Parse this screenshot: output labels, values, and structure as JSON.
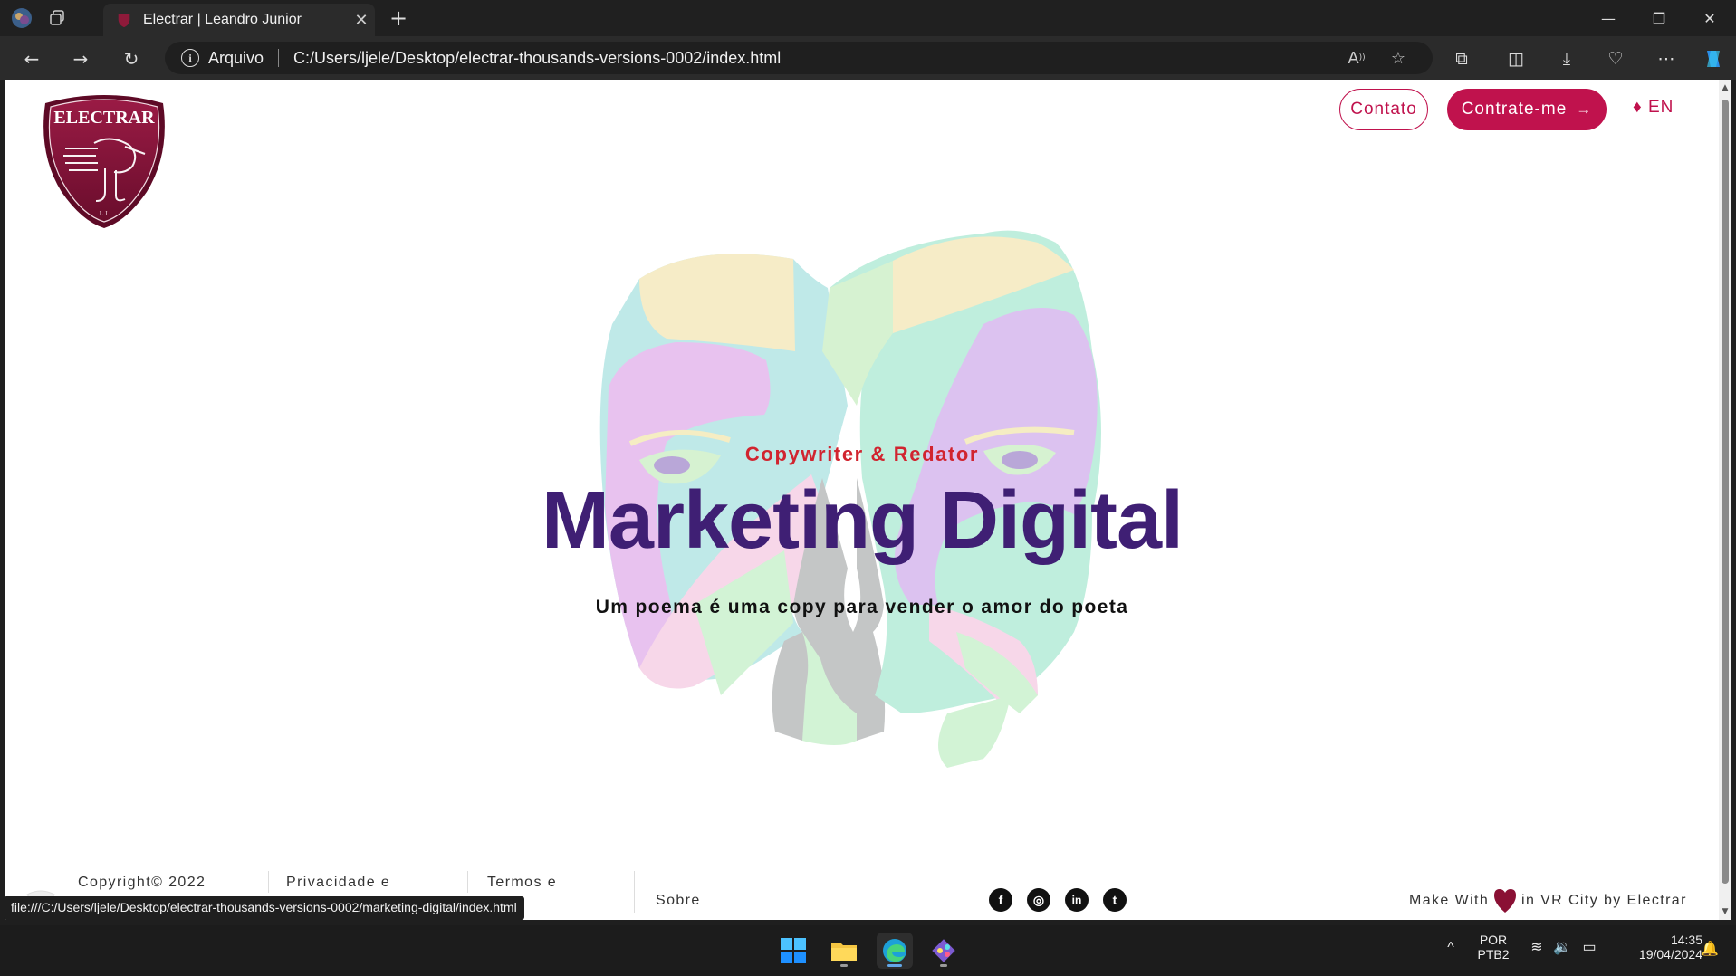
{
  "browser": {
    "tab_title": "Electrar | Leandro Junior",
    "tab_close": "✕",
    "new_tab": "+",
    "address_label": "Arquivo",
    "url": "C:/Users/ljele/Desktop/electrar-thousands-versions-0002/index.html",
    "status_link": "file:///C:/Users/ljele/Desktop/electrar-thousands-versions-0002/marketing-digital/index.html"
  },
  "site": {
    "logo_text": "ELECTRAR",
    "logo_initials": "L.J.",
    "nav": {
      "contato": "Contato",
      "contrate": "Contrate-me",
      "contrate_arrow": "→",
      "lang": "♦ EN"
    },
    "hero": {
      "kicker": "Copywriter & Redator",
      "title": "Marketing Digital",
      "subtitle": "Um poema é uma copy para vender o amor do poeta"
    },
    "footer": {
      "copyright": "Copyright© 2022",
      "privacy": "Privacidade e",
      "terms": "Termos e",
      "about": "Sobre",
      "made_with": "Make With",
      "made_in": "in VR City by Electrar",
      "social": [
        "facebook-icon",
        "instagram-icon",
        "linkedin-icon",
        "twitter-icon"
      ],
      "social_glyphs": [
        "f",
        "◎",
        "in",
        "t"
      ]
    }
  },
  "taskbar": {
    "lang_top": "POR",
    "lang_bottom": "PTB2",
    "time": "14:35",
    "date": "19/04/2024",
    "tray_chevron": "^"
  },
  "colors": {
    "brand": "#c0124d",
    "heading": "#3f1f74",
    "kicker": "#d1242f"
  }
}
